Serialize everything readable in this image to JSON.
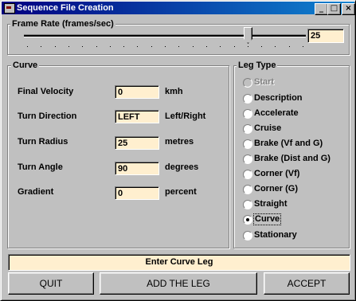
{
  "window": {
    "title": "Sequence File Creation",
    "controls": {
      "minimize": "_",
      "maximize": "□",
      "close": "×"
    }
  },
  "frame_rate": {
    "legend": "Frame Rate (frames/sec)",
    "value": "25",
    "slider_fraction": 0.8
  },
  "curve": {
    "legend": "Curve",
    "fields": [
      {
        "label": "Final Velocity",
        "value": "0",
        "unit": "kmh"
      },
      {
        "label": "Turn Direction",
        "value": "LEFT",
        "unit": "Left/Right"
      },
      {
        "label": "Turn Radius",
        "value": "25",
        "unit": "metres"
      },
      {
        "label": "Turn Angle",
        "value": "90",
        "unit": "degrees"
      },
      {
        "label": "Gradient",
        "value": "0",
        "unit": "percent"
      }
    ]
  },
  "leg_type": {
    "legend": "Leg Type",
    "options": [
      {
        "label": "Start",
        "selected": false,
        "disabled": true
      },
      {
        "label": "Description",
        "selected": false,
        "disabled": false
      },
      {
        "label": "Accelerate",
        "selected": false,
        "disabled": false
      },
      {
        "label": "Cruise",
        "selected": false,
        "disabled": false
      },
      {
        "label": "Brake (Vf and G)",
        "selected": false,
        "disabled": false
      },
      {
        "label": "Brake (Dist and G)",
        "selected": false,
        "disabled": false
      },
      {
        "label": "Corner (Vf)",
        "selected": false,
        "disabled": false
      },
      {
        "label": "Corner (G)",
        "selected": false,
        "disabled": false
      },
      {
        "label": "Straight",
        "selected": false,
        "disabled": false
      },
      {
        "label": "Curve",
        "selected": true,
        "disabled": false
      },
      {
        "label": "Stationary",
        "selected": false,
        "disabled": false
      }
    ]
  },
  "status_text": "Enter Curve Leg",
  "buttons": {
    "quit": "QUIT",
    "add": "ADD  THE LEG",
    "accept": "ACCEPT"
  },
  "colors": {
    "field_bg": "#ffefcf",
    "title_bar": "#000080",
    "face": "#c0c0c0"
  }
}
